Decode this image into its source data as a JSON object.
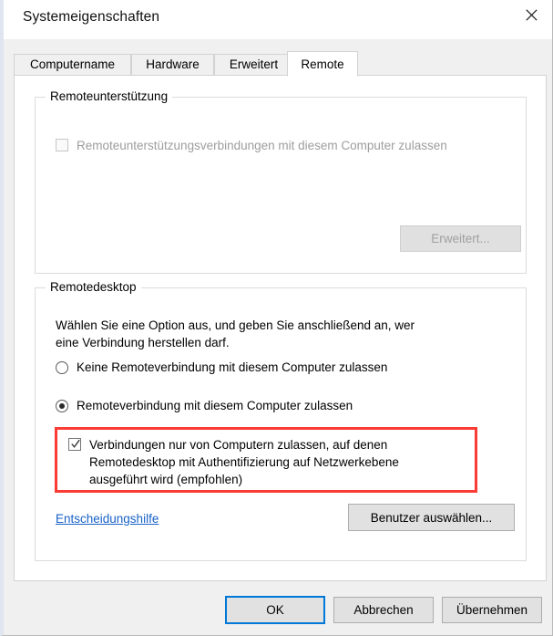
{
  "window": {
    "title": "Systemeigenschaften",
    "close_icon": "close-icon"
  },
  "tabs": [
    {
      "label": "Computername",
      "active": false
    },
    {
      "label": "Hardware",
      "active": false
    },
    {
      "label": "Erweitert",
      "active": false
    },
    {
      "label": "Remote",
      "active": true
    }
  ],
  "remote_assistance": {
    "legend": "Remoteunterstützung",
    "checkbox": {
      "label": "Remoteunterstützungsverbindungen mit diesem Computer zulassen",
      "checked": false,
      "enabled": false
    },
    "advanced_button": {
      "label": "Erweitert...",
      "enabled": false
    }
  },
  "remote_desktop": {
    "legend": "Remotedesktop",
    "description_line1": "Wählen Sie eine Option aus, und geben Sie anschließend an, wer",
    "description_line2": "eine Verbindung herstellen darf.",
    "radio_options": [
      {
        "label": "Keine Remoteverbindung mit diesem Computer zulassen",
        "selected": false
      },
      {
        "label": "Remoteverbindung mit diesem Computer zulassen",
        "selected": true
      }
    ],
    "nla_checkbox": {
      "label": "Verbindungen nur von Computern zulassen, auf denen\nRemotedesktop mit Authentifizierung auf Netzwerkebene\nausgeführt wird (empfohlen)",
      "checked": true,
      "highlighted": true
    },
    "help_link": "Entscheidungshilfe",
    "select_users_button": "Benutzer auswählen..."
  },
  "footer_buttons": [
    {
      "label": "OK",
      "default": true
    },
    {
      "label": "Abbrechen",
      "default": false
    },
    {
      "label": "Übernehmen",
      "default": false
    }
  ],
  "colors": {
    "accent": "#0078d7",
    "highlight": "#fa3c34",
    "link": "#1962c7",
    "dialog_bg": "#f0f0f0",
    "page_bg": "#ffffff"
  }
}
